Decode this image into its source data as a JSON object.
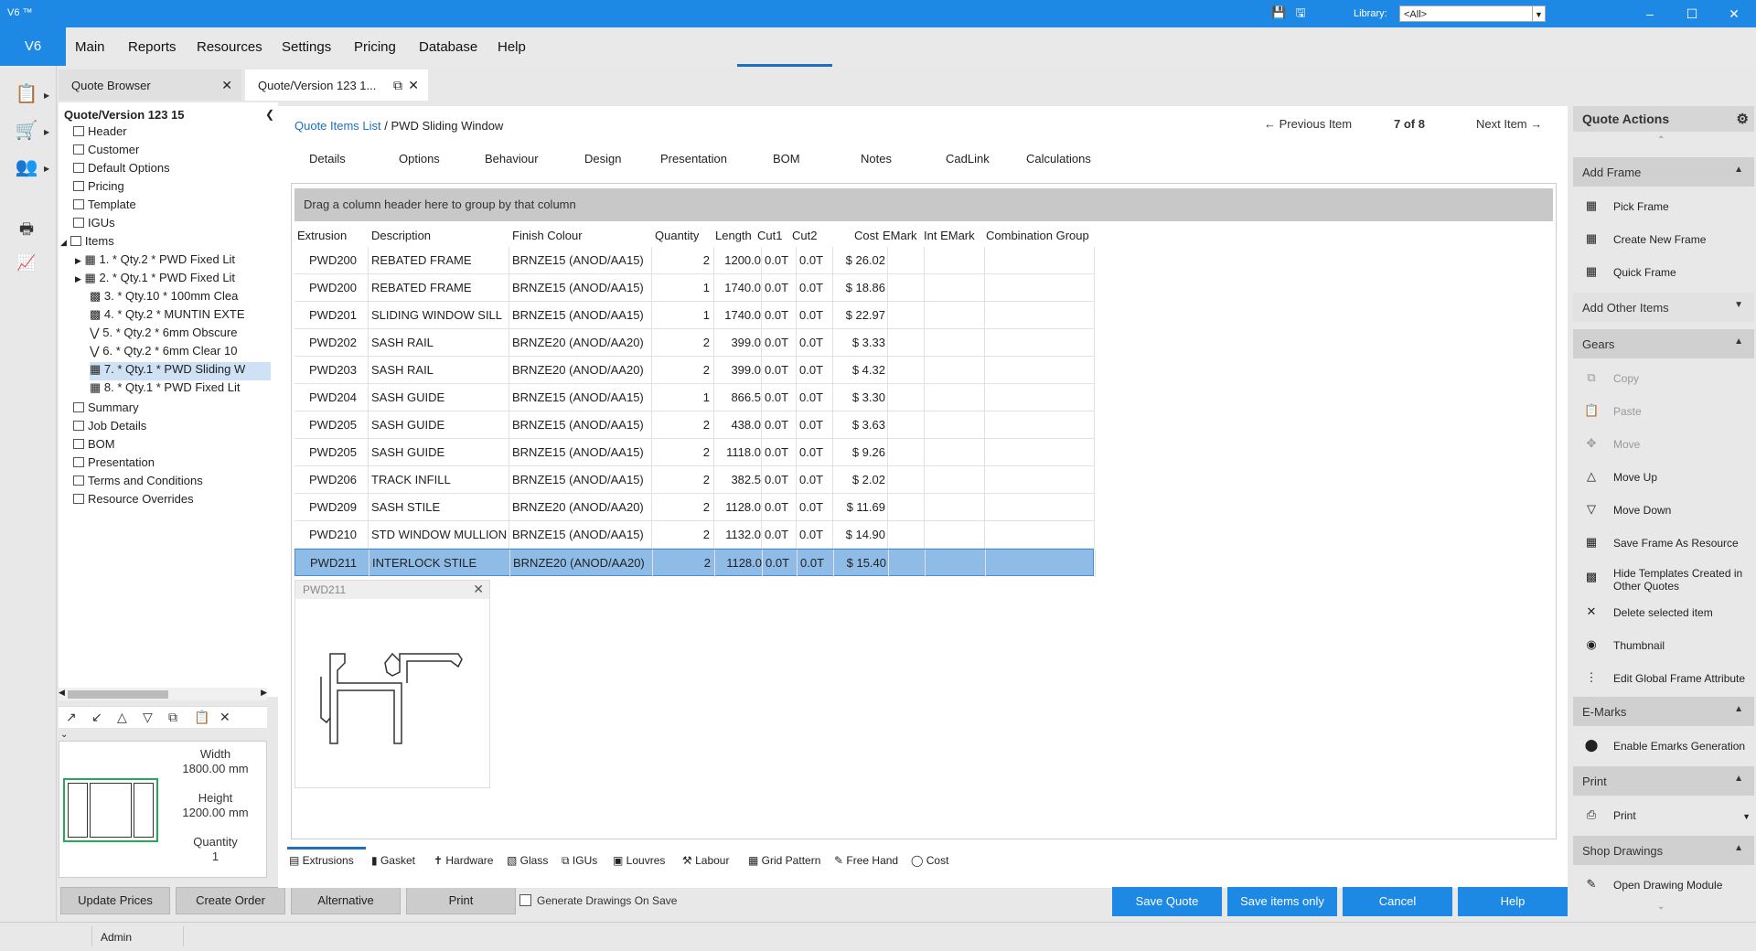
{
  "window": {
    "title": "V6 ™",
    "library_label": "Library:",
    "library_value": "<All>"
  },
  "menubar": {
    "logo": "V6",
    "items": [
      "Main",
      "Reports",
      "Resources",
      "Settings",
      "Pricing",
      "Database",
      "Help"
    ]
  },
  "tabs": [
    {
      "label": "Quote Browser"
    },
    {
      "label": "Quote/Version  123  1..."
    }
  ],
  "tree": {
    "title": "Quote/Version  123  15",
    "items": [
      {
        "label": "Header"
      },
      {
        "label": "Customer"
      },
      {
        "label": "Default Options"
      },
      {
        "label": "Pricing"
      },
      {
        "label": "Template"
      },
      {
        "label": "IGUs"
      },
      {
        "label": "Items"
      }
    ],
    "children": [
      {
        "label": "1.   *  Qty.2   *  PWD Fixed Lit"
      },
      {
        "label": "2.   *  Qty.1   *  PWD Fixed Lit"
      },
      {
        "label": "3.   *  Qty.10  *  100mm Clea"
      },
      {
        "label": "4.   *  Qty.2   *  MUNTIN EXTE"
      },
      {
        "label": "5.   *  Qty.2   *  6mm Obscure"
      },
      {
        "label": "6.   *  Qty.2   *  6mm Clear 10"
      },
      {
        "label": "7.   *  Qty.1   *  PWD Sliding W"
      },
      {
        "label": "8.   *  Qty.1   *  PWD Fixed Lit"
      }
    ],
    "after": [
      {
        "label": "Summary"
      },
      {
        "label": "Job Details"
      },
      {
        "label": "BOM"
      },
      {
        "label": "Presentation"
      },
      {
        "label": "Terms and Conditions"
      },
      {
        "label": "Resource Overrides"
      }
    ]
  },
  "preview": {
    "width_label": "Width",
    "width_value": "1800.00 mm",
    "height_label": "Height",
    "height_value": "1200.00 mm",
    "qty_label": "Quantity",
    "qty_value": "1"
  },
  "left_buttons": {
    "update": "Update Prices",
    "create": "Create Order",
    "alternative": "Alternative",
    "print": "Print"
  },
  "main": {
    "crumb_link": "Quote Items List",
    "crumb_sep": " / ",
    "crumb_current": "PWD Sliding Window",
    "prev": "Previous Item",
    "position": "7 of 8",
    "next": "Next Item",
    "subtabs": [
      "Details",
      "Options",
      "Behaviour",
      "Design",
      "Presentation",
      "BOM",
      "Notes",
      "CadLink",
      "Calculations"
    ],
    "group_hint": "Drag a column header here to group by that column",
    "columns": [
      "Extrusion",
      "Description",
      "Finish Colour",
      "Quantity",
      "Length",
      "Cut1",
      "Cut2",
      "Cost",
      "EMark",
      "Int EMark",
      "Combination Group"
    ],
    "rows": [
      [
        "PWD200",
        "REBATED FRAME",
        "BRNZE15 (ANOD/AA15)",
        "2",
        "1200.0",
        "0.0T",
        "0.0T",
        "$ 26.02"
      ],
      [
        "PWD200",
        "REBATED FRAME",
        "BRNZE15 (ANOD/AA15)",
        "1",
        "1740.0",
        "0.0T",
        "0.0T",
        "$ 18.86"
      ],
      [
        "PWD201",
        "SLIDING WINDOW SILL",
        "BRNZE15 (ANOD/AA15)",
        "1",
        "1740.0",
        "0.0T",
        "0.0T",
        "$ 22.97"
      ],
      [
        "PWD202",
        "SASH RAIL",
        "BRNZE20 (ANOD/AA20)",
        "2",
        "399.0",
        "0.0T",
        "0.0T",
        "$ 3.33"
      ],
      [
        "PWD203",
        "SASH RAIL",
        "BRNZE20 (ANOD/AA20)",
        "2",
        "399.0",
        "0.0T",
        "0.0T",
        "$ 4.32"
      ],
      [
        "PWD204",
        "SASH GUIDE",
        "BRNZE15 (ANOD/AA15)",
        "1",
        "866.5",
        "0.0T",
        "0.0T",
        "$ 3.30"
      ],
      [
        "PWD205",
        "SASH GUIDE",
        "BRNZE15 (ANOD/AA15)",
        "2",
        "438.0",
        "0.0T",
        "0.0T",
        "$ 3.63"
      ],
      [
        "PWD205",
        "SASH GUIDE",
        "BRNZE15 (ANOD/AA15)",
        "2",
        "1118.0",
        "0.0T",
        "0.0T",
        "$ 9.26"
      ],
      [
        "PWD206",
        "TRACK INFILL",
        "BRNZE15 (ANOD/AA15)",
        "2",
        "382.5",
        "0.0T",
        "0.0T",
        "$ 2.02"
      ],
      [
        "PWD209",
        "SASH STILE",
        "BRNZE20 (ANOD/AA20)",
        "2",
        "1128.0",
        "0.0T",
        "0.0T",
        "$ 11.69"
      ],
      [
        "PWD210",
        "STD WINDOW MULLION",
        "BRNZE15 (ANOD/AA15)",
        "2",
        "1132.0",
        "0.0T",
        "0.0T",
        "$ 14.90"
      ],
      [
        "PWD211",
        "INTERLOCK STILE",
        "BRNZE20 (ANOD/AA20)",
        "2",
        "1128.0",
        "0.0T",
        "0.0T",
        "$ 15.40"
      ]
    ],
    "thumb_title": "PWD211",
    "bottom_tabs": [
      "Extrusions",
      "Gasket",
      "Hardware",
      "Glass",
      "IGUs",
      "Louvres",
      "Labour",
      "Grid Pattern",
      "Free Hand",
      "Cost"
    ],
    "gen_drawings": "Generate Drawings On Save"
  },
  "action_buttons": {
    "save_quote": "Save Quote",
    "save_items": "Save items only",
    "cancel": "Cancel",
    "help": "Help"
  },
  "quote_actions": {
    "title": "Quote Actions",
    "add_frame": "Add Frame",
    "pick_frame": "Pick Frame",
    "create_new_frame": "Create New Frame",
    "quick_frame": "Quick Frame",
    "add_other": "Add Other Items",
    "gears": "Gears",
    "copy": "Copy",
    "paste": "Paste",
    "move": "Move",
    "move_up": "Move Up",
    "move_down": "Move Down",
    "save_frame_resource": "Save Frame As Resource",
    "hide_templates": "Hide Templates Created in Other Quotes",
    "delete_selected": "Delete selected item",
    "thumbnail": "Thumbnail",
    "edit_global": "Edit Global Frame Attribute",
    "emarks": "E-Marks",
    "enable_emarks": "Enable Emarks Generation",
    "print_sec": "Print",
    "print_item": "Print",
    "shop_drawings": "Shop Drawings",
    "open_drawing": "Open Drawing Module"
  },
  "status": {
    "user": "Admin"
  }
}
